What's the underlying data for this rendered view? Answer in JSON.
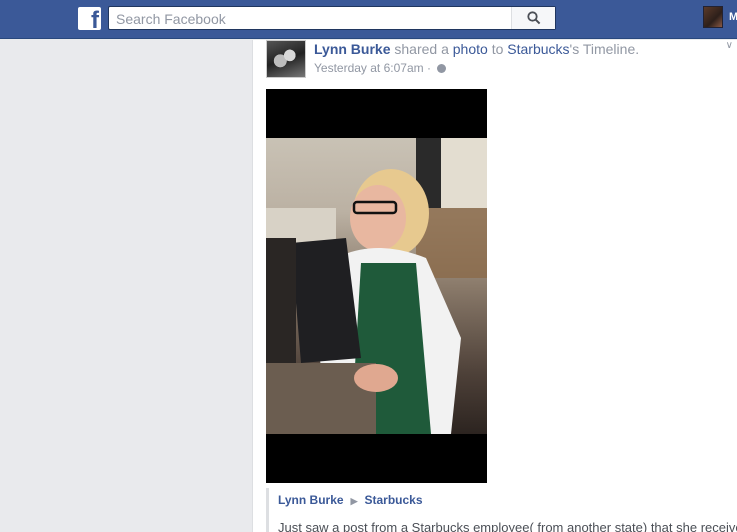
{
  "header": {
    "search_placeholder": "Search Facebook",
    "user_initial": "M"
  },
  "post": {
    "author": "Lynn Burke",
    "shared_a": "shared a",
    "photo_link": "photo",
    "to": "to",
    "page": "Starbucks",
    "timeline_suffix": "'s Timeline.",
    "timestamp": "Yesterday at 6:07am",
    "separator": "·"
  },
  "shared_story": {
    "from": "Lynn Burke",
    "to": "Starbucks",
    "text": "Just saw a post from a Starbucks employee( from another state) that she received"
  },
  "icons": {
    "logo": "facebook-logo-icon",
    "search": "search-icon",
    "audience": "globe-icon",
    "menu": "chevron-down-icon",
    "arrow": "triangle-right-icon"
  }
}
